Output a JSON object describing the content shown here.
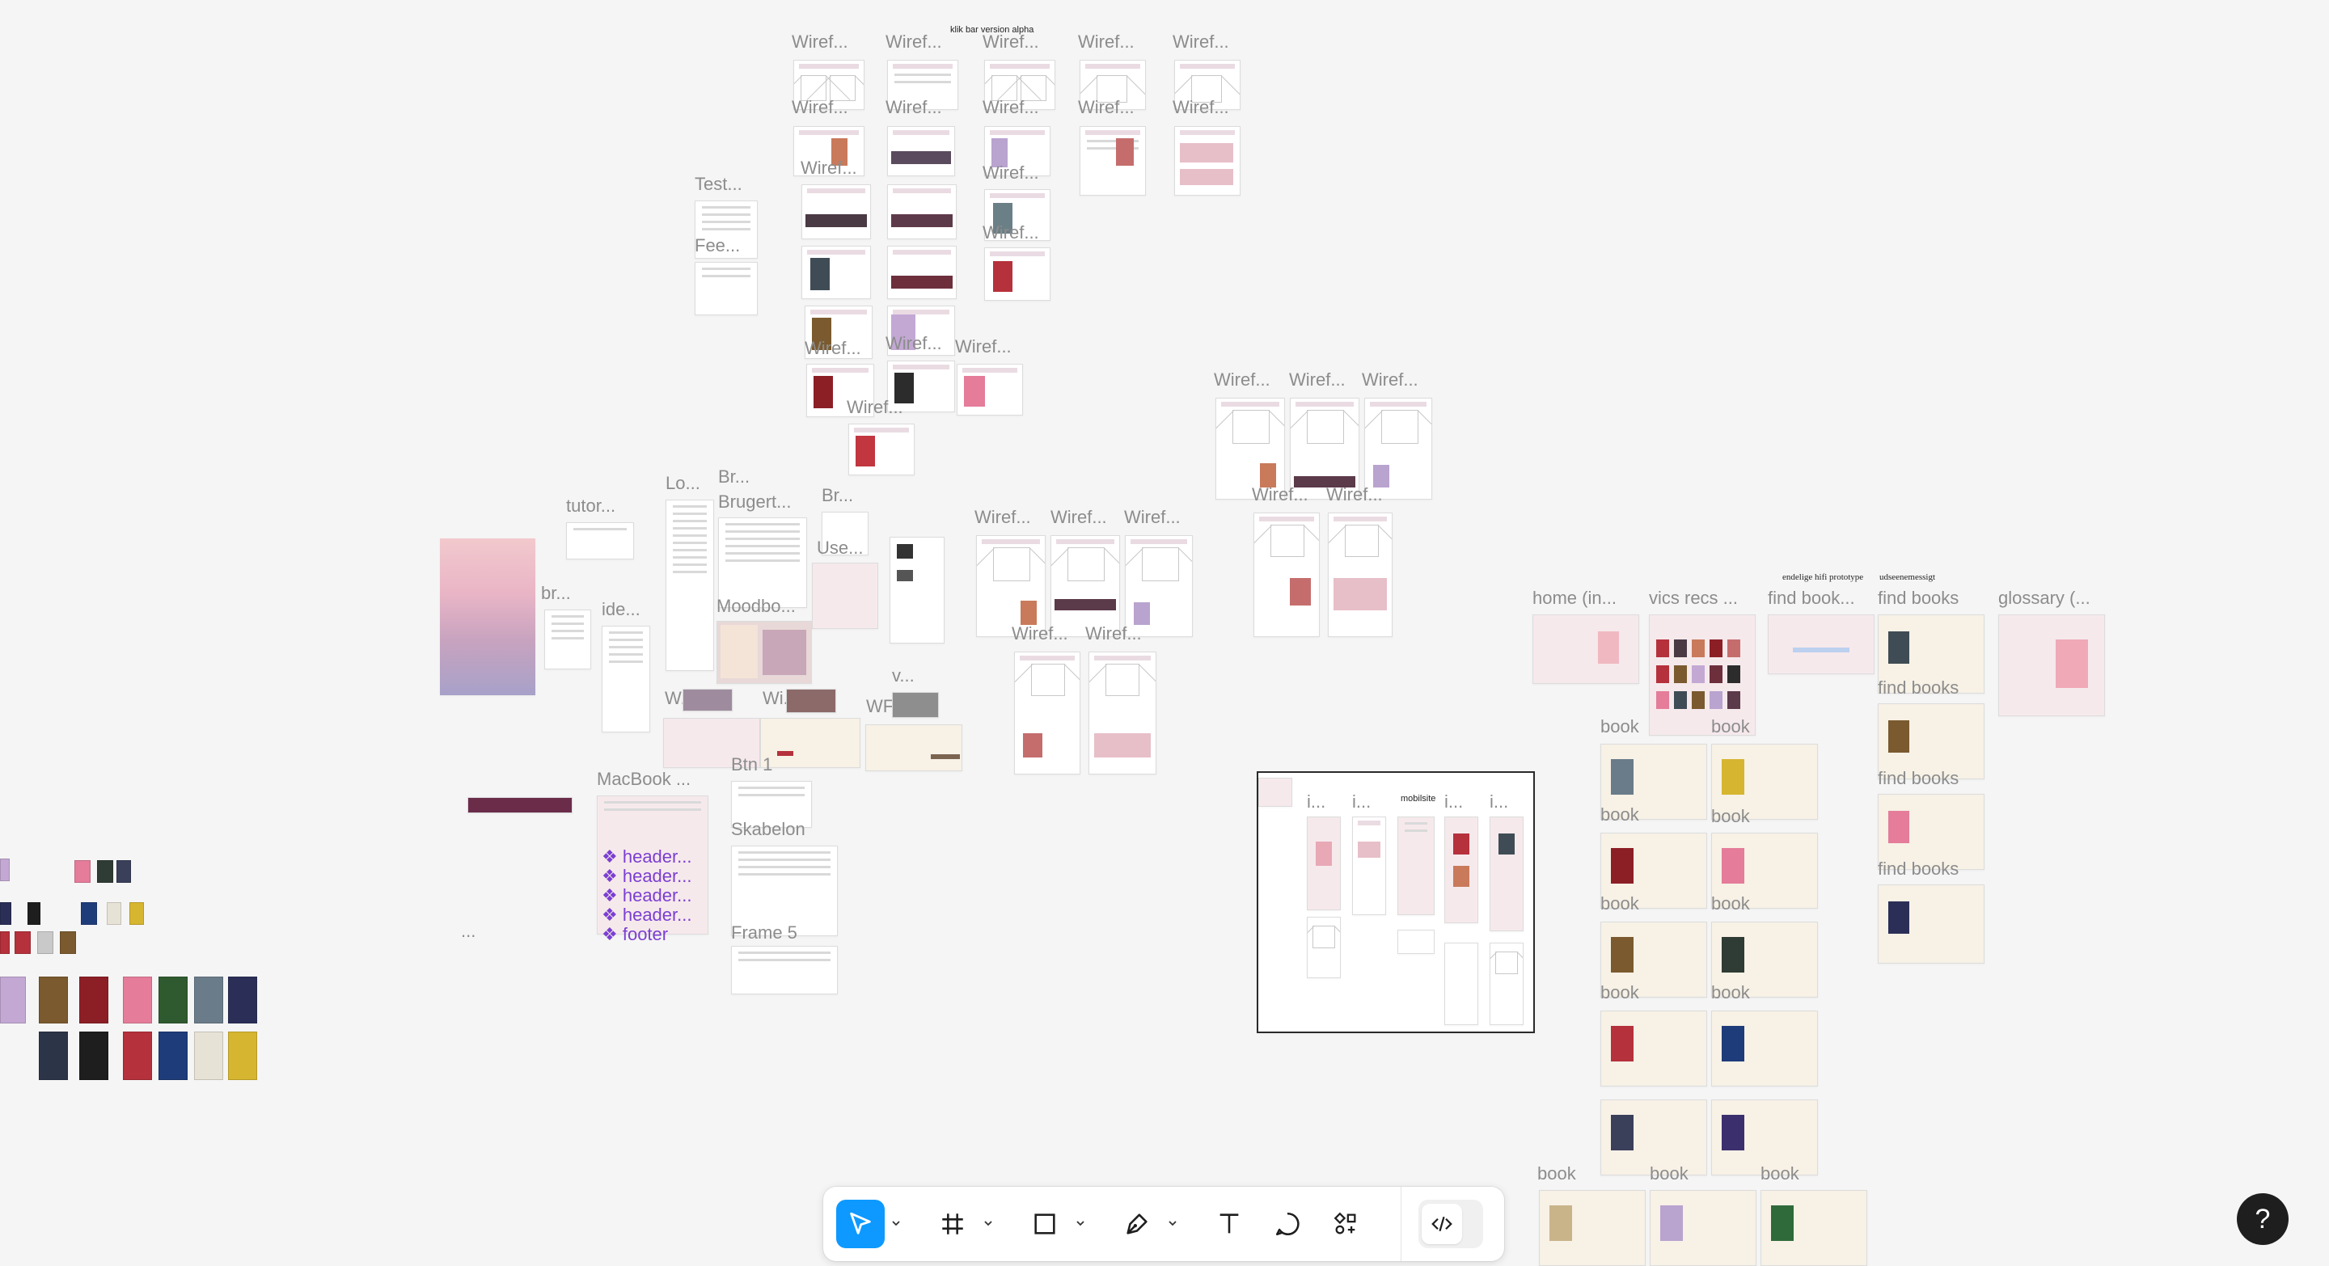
{
  "canvas": {
    "labels": {
      "wiref": "Wiref...",
      "test": "Test...",
      "fee": "Fee...",
      "lo": "Lo...",
      "br": "Br...",
      "brugert": "Brugert...",
      "br2": "Br...",
      "tutor": "tutor...",
      "br3": "br...",
      "ide": "ide...",
      "use": "Use...",
      "moodbo": "Moodbo...",
      "w": "W...",
      "wi": "Wi...",
      "wf": "WF...",
      "v": "v...",
      "macbook": "MacBook ...",
      "btn": "Btn 1",
      "skabelon": "Skabelon",
      "frame": "Frame 5",
      "dots": "...",
      "ellipsis_i": "i...",
      "home": "home (in...",
      "vics": "vics recs ...",
      "findbook": "find book...",
      "findbooks": "find books",
      "glossary": "glossary (...",
      "book": "book"
    },
    "header_items": [
      "header...",
      "header...",
      "header...",
      "header...",
      "footer"
    ],
    "tiny_texts": {
      "klik_bar": "klik bar version alpha",
      "mobilsite": "mobilsite",
      "endelige": "endelige hifi prototype",
      "udseende": "udseenemessigt"
    }
  },
  "toolbar": {
    "tools": [
      {
        "name": "move-tool",
        "icon": "cursor-icon"
      },
      {
        "name": "frame-tool",
        "icon": "hash-frame-icon"
      },
      {
        "name": "shape-tool",
        "icon": "square-icon"
      },
      {
        "name": "pen-tool",
        "icon": "pen-icon"
      },
      {
        "name": "text-tool",
        "icon": "text-icon"
      },
      {
        "name": "comment-tool",
        "icon": "comment-icon"
      },
      {
        "name": "actions-tool",
        "icon": "components-icon"
      },
      {
        "name": "dev-mode-toggle",
        "icon": "code-icon"
      }
    ]
  },
  "help": {
    "label": "?"
  },
  "colors": {
    "accent": "#0d99ff",
    "canvas_bg": "#f5f5f5",
    "label_gray": "#8c8c8c",
    "purple_component": "#7b3fd1"
  }
}
